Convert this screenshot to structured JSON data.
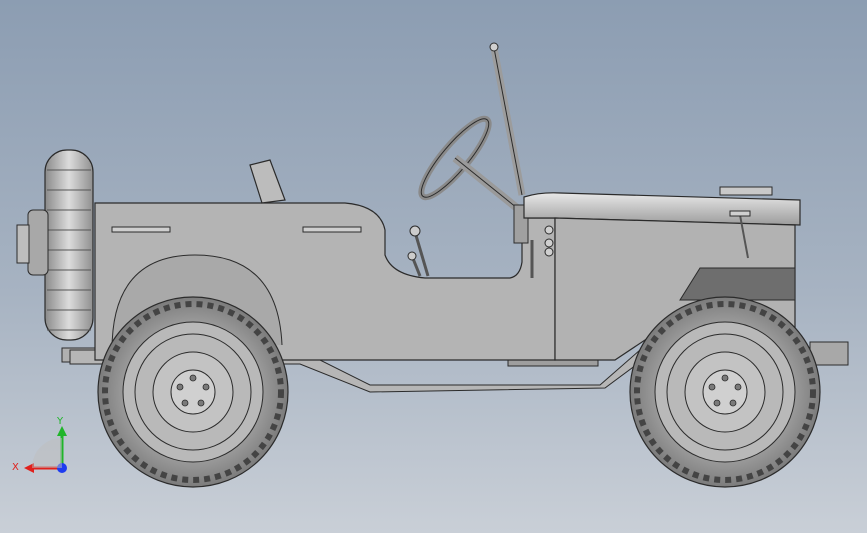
{
  "viewport": {
    "background_top": "#8c9db2",
    "background_bottom": "#c9cfd7"
  },
  "model": {
    "body_color": "#b4b4b4",
    "tire_color": "#9a9a9a",
    "dark_panel_color": "#6e6e6e",
    "edge_color": "#2b2b2b"
  },
  "triad": {
    "x_label": "X",
    "y_label": "Y",
    "x_color": "#e0201c",
    "y_color": "#1fb52a",
    "z_color": "#1e3cf0"
  }
}
